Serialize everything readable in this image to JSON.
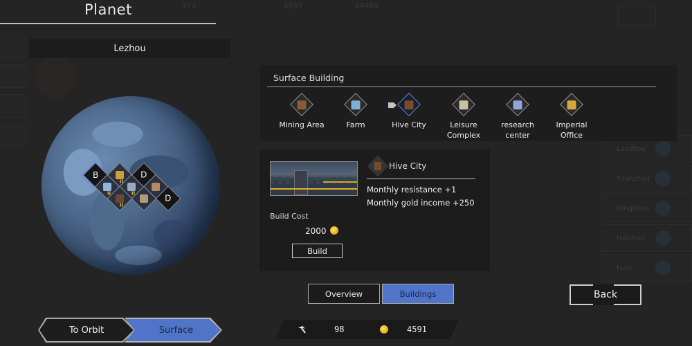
{
  "screen_title": "Planet",
  "planet": {
    "name": "Lezhou",
    "slots": [
      {
        "label": "B",
        "kind": "empty",
        "selected": true
      },
      {
        "label": "",
        "kind": "imperial-office",
        "tier": "II"
      },
      {
        "label": "D",
        "kind": "empty"
      },
      {
        "label": "",
        "kind": "farm",
        "tier": "II"
      },
      {
        "label": "",
        "kind": "leisure-complex",
        "tier": "II"
      },
      {
        "label": "",
        "kind": "mining-area"
      },
      {
        "label": "",
        "kind": "hive-city",
        "tier": "II"
      },
      {
        "label": "",
        "kind": "research-center"
      },
      {
        "label": "D",
        "kind": "empty"
      }
    ]
  },
  "surface_building": {
    "title": "Surface Building",
    "options": [
      {
        "label": "Mining Area",
        "icon": "mining-area-icon",
        "color": "#8a5a3a"
      },
      {
        "label": "Farm",
        "icon": "farm-icon",
        "color": "#7fb0d6"
      },
      {
        "label": "Hive City",
        "icon": "hive-city-icon",
        "color": "#7a4b2a",
        "selected": true
      },
      {
        "label": "Leisure\nComplex",
        "icon": "leisure-complex-icon",
        "color": "#c9c2a0"
      },
      {
        "label": "research\ncenter",
        "icon": "research-center-icon",
        "color": "#8fa7d8"
      },
      {
        "label": "Imperial\nOffice",
        "icon": "imperial-office-icon",
        "color": "#d2a83a"
      }
    ]
  },
  "detail": {
    "name": "Hive City",
    "stats": [
      "Monthly resistance  +1",
      "Monthly gold income +250"
    ],
    "build_cost_label": "Build Cost",
    "build_cost": "2000",
    "build_label": "Build"
  },
  "tabs": {
    "overview": "Overview",
    "buildings": "Buildings",
    "active": "Buildings"
  },
  "resources": {
    "production": "98",
    "gold": "4591"
  },
  "view_toggle": {
    "orbit": "To Orbit",
    "surface": "Surface",
    "active": "Surface"
  },
  "back_label": "Back",
  "background": {
    "planet_list": [
      "Laozhou",
      "Yuanzhou",
      "Ningzhou",
      "Haizhou",
      "Kunl"
    ],
    "top_values": [
      "373",
      "4591",
      "14469"
    ]
  },
  "colors": {
    "accent": "#4f74c8",
    "panel": "#1d1d1d",
    "gold": "#e4a817"
  }
}
